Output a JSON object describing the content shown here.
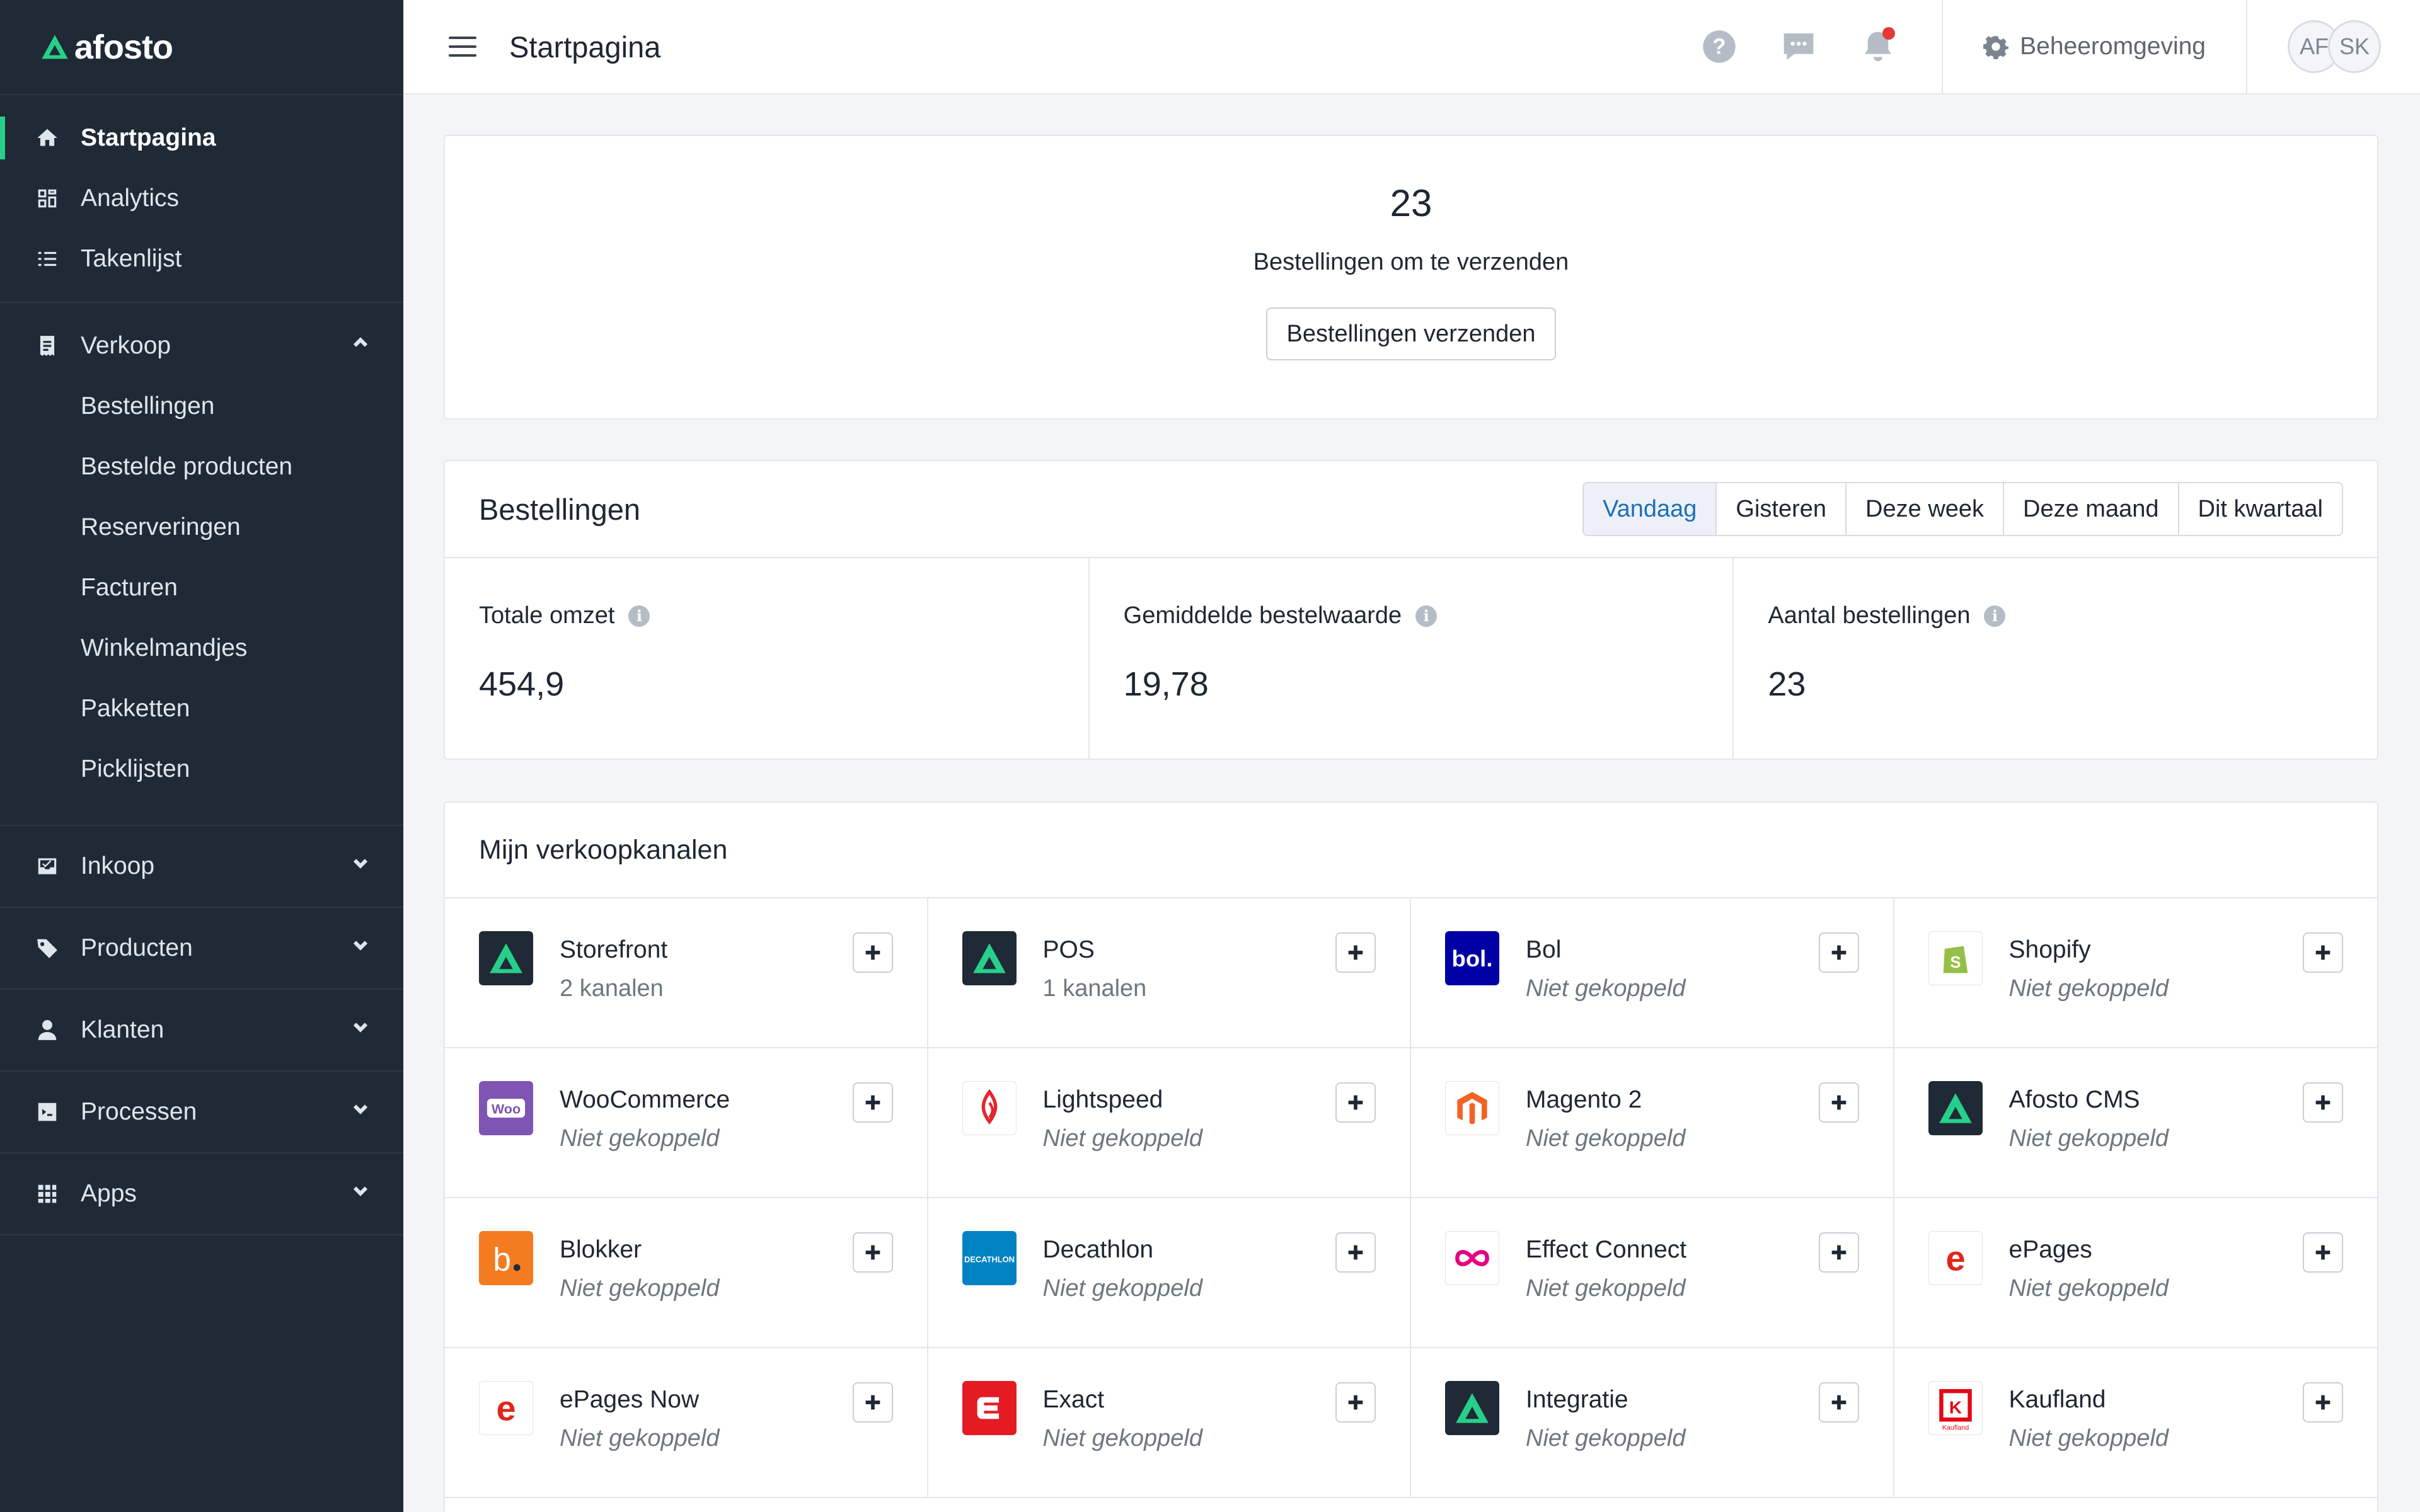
{
  "app": {
    "logo_text": "afosto"
  },
  "sidebar": {
    "primary": [
      {
        "label": "Startpagina",
        "icon": "home-icon",
        "active": true
      },
      {
        "label": "Analytics",
        "icon": "analytics-icon"
      },
      {
        "label": "Takenlijst",
        "icon": "tasklist-icon"
      }
    ],
    "verkoop": {
      "label": "Verkoop",
      "icon": "receipt-icon",
      "expanded": true,
      "items": [
        "Bestellingen",
        "Bestelde producten",
        "Reserveringen",
        "Facturen",
        "Winkelmandjes",
        "Pakketten",
        "Picklijsten"
      ]
    },
    "groups": [
      {
        "label": "Inkoop",
        "icon": "inbox-icon"
      },
      {
        "label": "Producten",
        "icon": "tag-icon"
      },
      {
        "label": "Klanten",
        "icon": "user-icon"
      },
      {
        "label": "Processen",
        "icon": "processes-icon"
      },
      {
        "label": "Apps",
        "icon": "apps-grid-icon"
      }
    ]
  },
  "topbar": {
    "title": "Startpagina",
    "settings_label": "Beheeromgeving",
    "avatars": [
      "AF",
      "SK"
    ],
    "has_notification": true
  },
  "shipping": {
    "count": "23",
    "label": "Bestellingen om te verzenden",
    "button": "Bestellingen verzenden"
  },
  "orders": {
    "title": "Bestellingen",
    "periods": [
      "Vandaag",
      "Gisteren",
      "Deze week",
      "Deze maand",
      "Dit kwartaal"
    ],
    "active_period": "Vandaag",
    "stats": [
      {
        "label": "Totale omzet",
        "value": "454,9"
      },
      {
        "label": "Gemiddelde bestelwaarde",
        "value": "19,78"
      },
      {
        "label": "Aantal bestellingen",
        "value": "23"
      }
    ]
  },
  "channels": {
    "title": "Mijn verkoopkanalen",
    "items": [
      {
        "name": "Storefront",
        "status": "2 kanalen",
        "connected": true,
        "logo": "afosto"
      },
      {
        "name": "POS",
        "status": "1 kanalen",
        "connected": true,
        "logo": "afosto"
      },
      {
        "name": "Bol",
        "status": "Niet gekoppeld",
        "connected": false,
        "logo": "bol"
      },
      {
        "name": "Shopify",
        "status": "Niet gekoppeld",
        "connected": false,
        "logo": "shopify"
      },
      {
        "name": "WooCommerce",
        "status": "Niet gekoppeld",
        "connected": false,
        "logo": "woo"
      },
      {
        "name": "Lightspeed",
        "status": "Niet gekoppeld",
        "connected": false,
        "logo": "lightspeed"
      },
      {
        "name": "Magento 2",
        "status": "Niet gekoppeld",
        "connected": false,
        "logo": "magento"
      },
      {
        "name": "Afosto CMS",
        "status": "Niet gekoppeld",
        "connected": false,
        "logo": "afosto"
      },
      {
        "name": "Blokker",
        "status": "Niet gekoppeld",
        "connected": false,
        "logo": "blokker"
      },
      {
        "name": "Decathlon",
        "status": "Niet gekoppeld",
        "connected": false,
        "logo": "decathlon"
      },
      {
        "name": "Effect Connect",
        "status": "Niet gekoppeld",
        "connected": false,
        "logo": "effect"
      },
      {
        "name": "ePages",
        "status": "Niet gekoppeld",
        "connected": false,
        "logo": "epages"
      },
      {
        "name": "ePages Now",
        "status": "Niet gekoppeld",
        "connected": false,
        "logo": "epages"
      },
      {
        "name": "Exact",
        "status": "Niet gekoppeld",
        "connected": false,
        "logo": "exact"
      },
      {
        "name": "Integratie",
        "status": "Niet gekoppeld",
        "connected": false,
        "logo": "afosto"
      },
      {
        "name": "Kaufland",
        "status": "Niet gekoppeld",
        "connected": false,
        "logo": "kaufland"
      }
    ]
  },
  "colors": {
    "sidebar_bg": "#1f2a36",
    "accent_green": "#27d08a",
    "active_blue": "#1d6fb8",
    "notification_red": "#e53935"
  }
}
